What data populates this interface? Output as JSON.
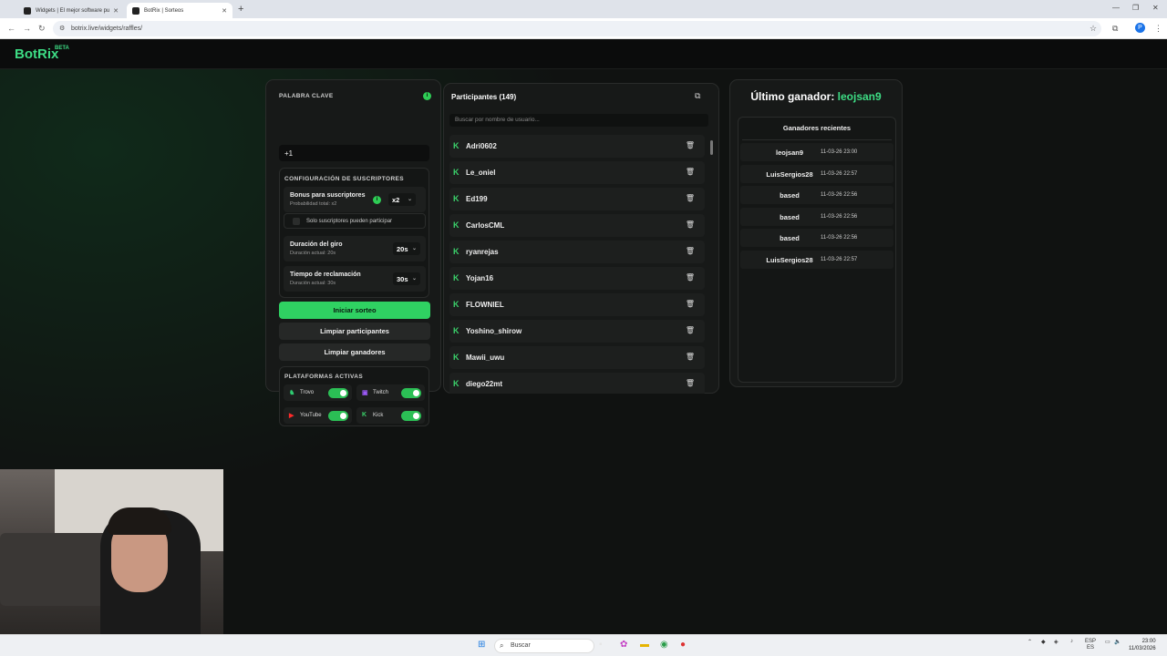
{
  "browser": {
    "tabs": [
      {
        "title": "Widgets | El mejor software pu",
        "active": false
      },
      {
        "title": "BotRix | Sorteos",
        "active": true
      }
    ],
    "url": "botrix.live/widgets/raffles/"
  },
  "app": {
    "logo": "BotRix",
    "beta": "BETA"
  },
  "settings": {
    "keyword_label": "PALABRA CLAVE",
    "keyword_value": "+1",
    "subs_label": "CONFIGURACIÓN DE SUSCRIPTORES",
    "bonus_title": "Bonus para suscriptores",
    "bonus_sub": "Probabilidad total: x2",
    "bonus_value": "x2",
    "subs_only": "Solo suscriptores pueden participar",
    "spin_title": "Duración del giro",
    "spin_sub": "Duración actual: 20s",
    "spin_value": "20s",
    "claim_title": "Tiempo de reclamación",
    "claim_sub": "Duración actual: 30s",
    "claim_value": "30s",
    "start_btn": "Iniciar sorteo",
    "clear_participants_btn": "Limpiar participantes",
    "clear_winners_btn": "Limpiar ganadores",
    "platforms_label": "PLATAFORMAS ACTIVAS",
    "platforms": [
      {
        "name": "Trovo",
        "on": true
      },
      {
        "name": "Twitch",
        "on": true
      },
      {
        "name": "YouTube",
        "on": true
      },
      {
        "name": "Kick",
        "on": true
      }
    ]
  },
  "participants": {
    "title": "Participantes (149)",
    "search_placeholder": "Buscar por nombre de usuario...",
    "list": [
      "Adri0602",
      "Le_oniel",
      "Ed199",
      "CarlosCML",
      "ryanrejas",
      "Yojan16",
      "FLOWNIEL",
      "Yoshino_shirow",
      "Mawii_uwu",
      "diego22mt"
    ]
  },
  "winners": {
    "last_label": "Último ganador:",
    "last_name": "leojsan9",
    "recent_title": "Ganadores recientes",
    "list": [
      {
        "name": "leojsan9",
        "time": "11-03-26 23:00"
      },
      {
        "name": "LuisSergios28",
        "time": "11-03-26 22:57"
      },
      {
        "name": "based",
        "time": "11-03-26 22:56"
      },
      {
        "name": "based",
        "time": "11-03-26 22:56"
      },
      {
        "name": "based",
        "time": "11-03-26 22:56"
      },
      {
        "name": "LuisSergios28",
        "time": "11-03-26 22:57"
      }
    ]
  },
  "taskbar": {
    "search": "Buscar",
    "lang": "ESP",
    "lang2": "ES",
    "time": "23:00",
    "date": "11/03/2026"
  },
  "colors": {
    "accent": "#2fd162",
    "kick": "#3bd36b"
  }
}
